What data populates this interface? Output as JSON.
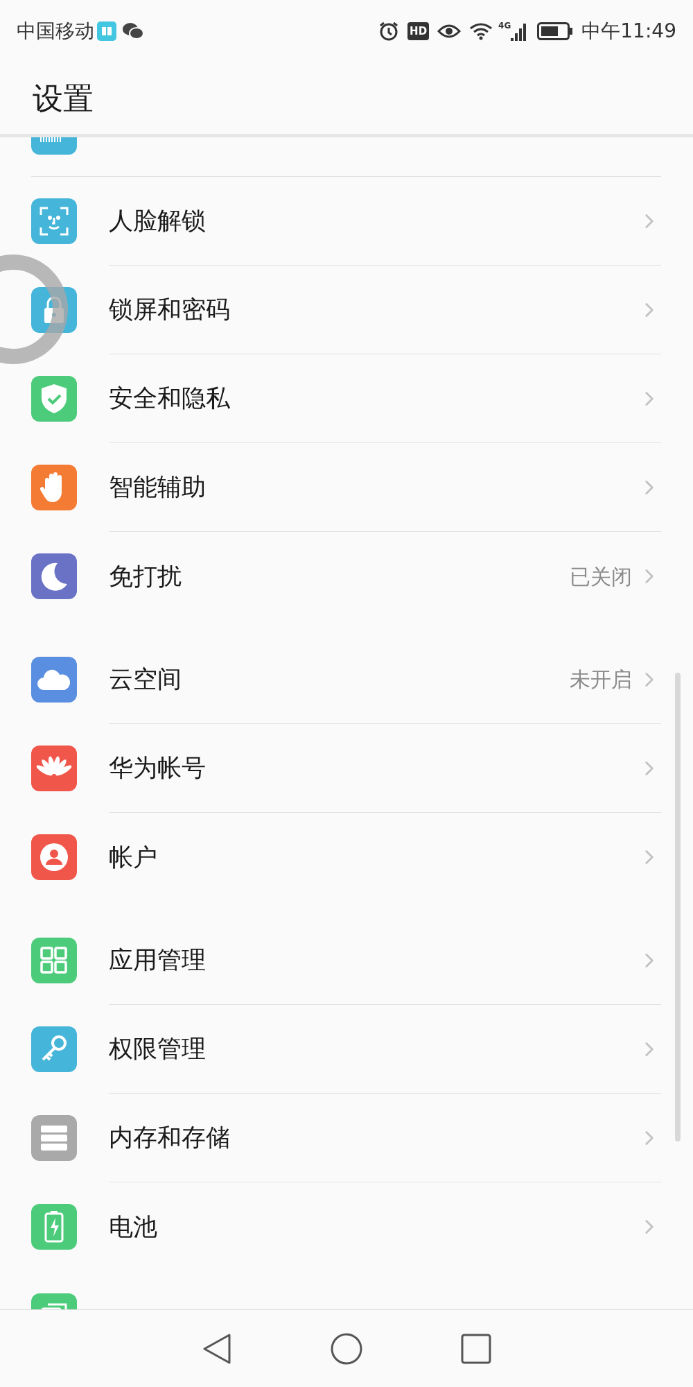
{
  "status_bar": {
    "carrier": "中国移动",
    "hd_badge": "HD",
    "network": "4G",
    "time": "中午11:49"
  },
  "title": "设置",
  "sections": [
    {
      "items": [
        {
          "kind": "cut_top"
        },
        {
          "kind": "row",
          "label": "人脸解锁"
        },
        {
          "kind": "row",
          "label": "锁屏和密码"
        },
        {
          "kind": "row",
          "label": "安全和隐私"
        },
        {
          "kind": "row",
          "label": "智能辅助"
        },
        {
          "kind": "row",
          "label": "免打扰",
          "value": "已关闭"
        }
      ]
    },
    {
      "items": [
        {
          "kind": "row",
          "label": "云空间",
          "value": "未开启"
        },
        {
          "kind": "row",
          "label": "华为帐号"
        },
        {
          "kind": "row",
          "label": "帐户"
        }
      ]
    },
    {
      "items": [
        {
          "kind": "row",
          "label": "应用管理"
        },
        {
          "kind": "row",
          "label": "权限管理"
        },
        {
          "kind": "row",
          "label": "内存和存储"
        },
        {
          "kind": "row",
          "label": "电池"
        },
        {
          "kind": "cut_bottom"
        }
      ]
    }
  ]
}
